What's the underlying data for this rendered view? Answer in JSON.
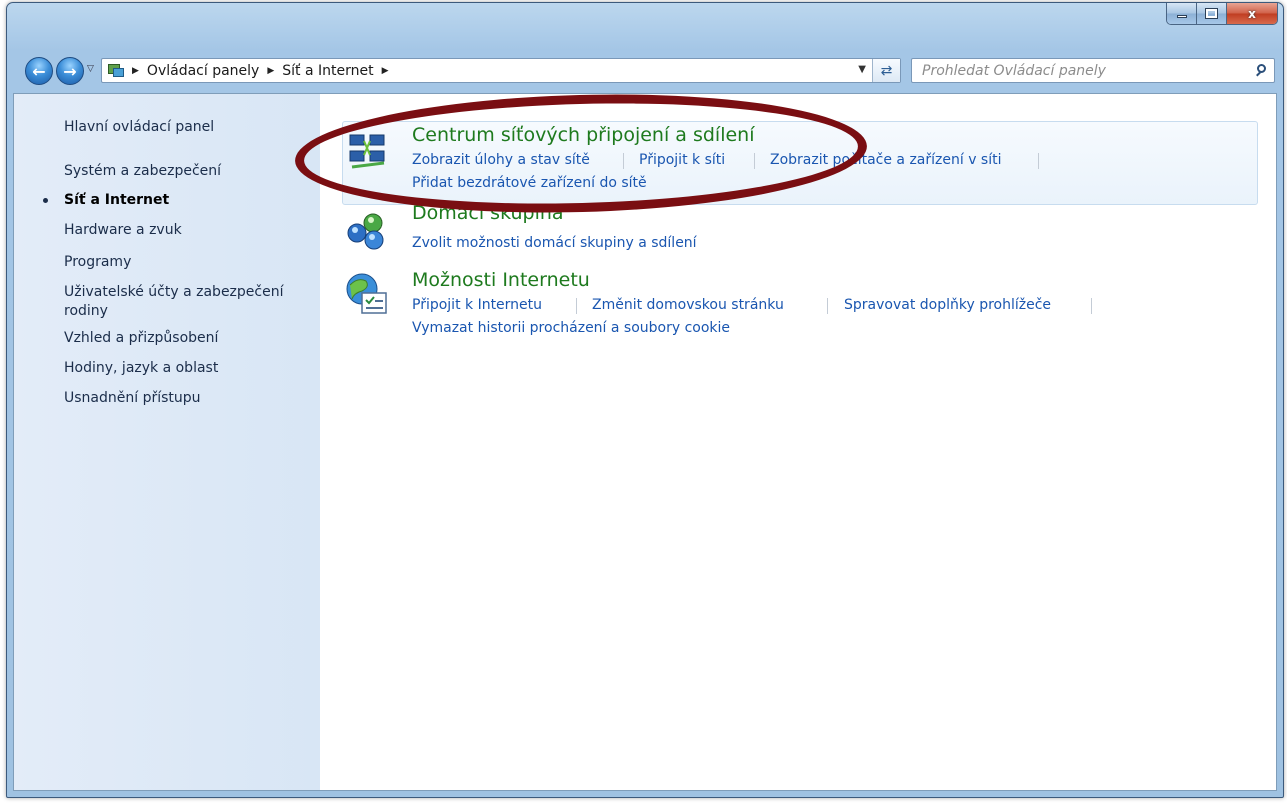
{
  "window": {
    "caption_buttons": {
      "minimize": "minimize",
      "maximize": "maximize",
      "close": "x"
    }
  },
  "address_bar": {
    "breadcrumbs": [
      "Ovládací panely",
      "Síť a Internet"
    ],
    "search_placeholder": "Prohledat Ovládací panely"
  },
  "sidebar": {
    "items": [
      {
        "label": "Hlavní ovládací panel",
        "active": false
      },
      {
        "label": "Systém a zabezpečení",
        "active": false
      },
      {
        "label": "Síť a Internet",
        "active": true
      },
      {
        "label": "Hardware a zvuk",
        "active": false
      },
      {
        "label": "Programy",
        "active": false
      },
      {
        "label": "Uživatelské účty a zabezpečení",
        "active": false
      },
      {
        "label": "rodiny",
        "active": false
      },
      {
        "label": "Vzhled a přizpůsobení",
        "active": false
      },
      {
        "label": "Hodiny, jazyk a oblast",
        "active": false
      },
      {
        "label": "Usnadnění přístupu",
        "active": false
      }
    ]
  },
  "categories": [
    {
      "title": "Centrum síťových připojení a sdílení",
      "icon": "network-center-icon",
      "links": [
        "Zobrazit úlohy a stav sítě",
        "Připojit k síti",
        "Zobrazit počítače a zařízení v síti",
        "Přidat bezdrátové zařízení do sítě"
      ]
    },
    {
      "title": "Domácí skupina",
      "icon": "homegroup-icon",
      "links": [
        "Zvolit možnosti domácí skupiny a sdílení"
      ]
    },
    {
      "title": "Možnosti Internetu",
      "icon": "internet-options-icon",
      "links": [
        "Připojit k Internetu",
        "Změnit domovskou stránku",
        "Spravovat doplňky prohlížeče",
        "Vymazat historii procházení a soubory cookie"
      ]
    }
  ],
  "colors": {
    "title_green": "#1e7a1e",
    "link_blue": "#1a56b0",
    "annotation_red": "#7a0e12",
    "frame_blue": "#9fc2e2"
  }
}
